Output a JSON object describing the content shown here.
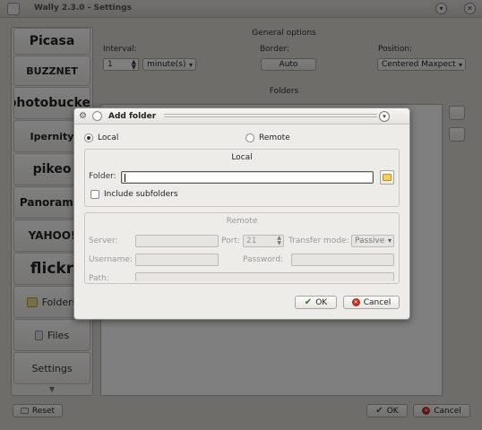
{
  "window": {
    "title": "Wally 2.3.0 - Settings"
  },
  "sidebar": {
    "items": [
      {
        "label": "Picasa",
        "kind": "logo"
      },
      {
        "label": "BUZZNET",
        "kind": "logo"
      },
      {
        "label": "photobucket",
        "kind": "logo"
      },
      {
        "label": "Ipernity",
        "kind": "logo"
      },
      {
        "label": "pikeo",
        "kind": "logo"
      },
      {
        "label": "Panoramio",
        "kind": "logo"
      },
      {
        "label": "YAHOO!",
        "kind": "logo"
      },
      {
        "label": "flickr",
        "kind": "logo"
      },
      {
        "label": "Folders",
        "kind": "text",
        "icon": "folder-icon"
      },
      {
        "label": "Files",
        "kind": "text",
        "icon": "files-icon"
      },
      {
        "label": "Settings",
        "kind": "text"
      }
    ]
  },
  "general": {
    "title": "General options",
    "interval_label": "Interval:",
    "interval_value": "1",
    "interval_unit": "minute(s)",
    "border_label": "Border:",
    "border_value": "Auto",
    "position_label": "Position:",
    "position_value": "Centered Maxpect"
  },
  "folders": {
    "title": "Folders"
  },
  "footer": {
    "reset_label": "Reset",
    "ok_label": "OK",
    "cancel_label": "Cancel"
  },
  "dialog": {
    "title": "Add folder",
    "source_local_label": "Local",
    "source_remote_label": "Remote",
    "selected_source": "Local",
    "local": {
      "title": "Local",
      "folder_label": "Folder:",
      "folder_value": "",
      "include_subfolders_label": "Include subfolders",
      "include_subfolders_checked": false
    },
    "remote": {
      "title": "Remote",
      "server_label": "Server:",
      "port_label": "Port:",
      "port_value": "21",
      "transfer_mode_label": "Transfer mode:",
      "transfer_mode_value": "Passive",
      "username_label": "Username:",
      "password_label": "Password:",
      "path_label": "Path:"
    },
    "ok_label": "OK",
    "cancel_label": "Cancel"
  },
  "colors": {
    "ok_accent": "#2a7a2a",
    "cancel_accent": "#c8281c",
    "folder_accent": "#f1cf5e"
  }
}
